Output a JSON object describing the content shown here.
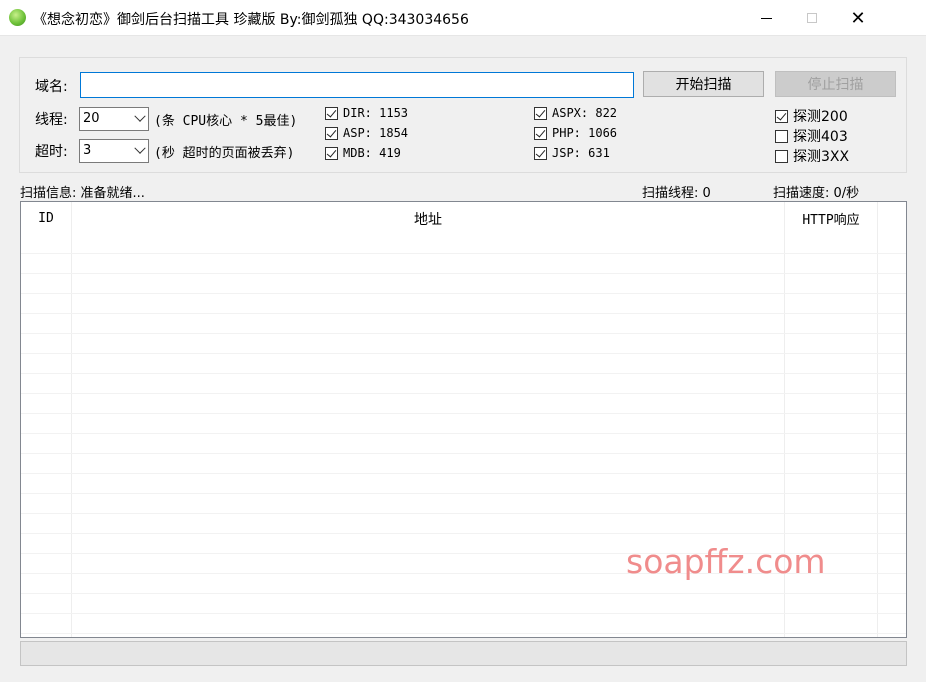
{
  "window": {
    "title": "《想念初恋》御剑后台扫描工具 珍藏版 By:御剑孤独 QQ:343034656",
    "controls": {
      "minimize": "",
      "maximize": "",
      "close": "✕"
    }
  },
  "form": {
    "domain_label": "域名:",
    "domain_value": "",
    "threads_label": "线程:",
    "threads_value": "20",
    "threads_hint": "(条 CPU核心 * 5最佳)",
    "timeout_label": "超时:",
    "timeout_value": "3",
    "timeout_hint": "(秒 超时的页面被丢弃)",
    "start_button": "开始扫描",
    "stop_button": "停止扫描"
  },
  "dictionaries": [
    {
      "label": "DIR: 1153",
      "checked": true
    },
    {
      "label": "ASP: 1854",
      "checked": true
    },
    {
      "label": "MDB: 419",
      "checked": true
    },
    {
      "label": "ASPX: 822",
      "checked": true
    },
    {
      "label": "PHP: 1066",
      "checked": true
    },
    {
      "label": "JSP: 631",
      "checked": true
    }
  ],
  "probes": [
    {
      "label": "探测200",
      "checked": true
    },
    {
      "label": "探测403",
      "checked": false
    },
    {
      "label": "探测3XX",
      "checked": false
    }
  ],
  "status": {
    "info": "扫描信息: 准备就绪...",
    "threads": "扫描线程: 0",
    "speed": "扫描速度: 0/秒"
  },
  "results": {
    "columns": [
      "ID",
      "地址",
      "HTTP响应"
    ],
    "rows": []
  },
  "watermark": "soapffz.com"
}
